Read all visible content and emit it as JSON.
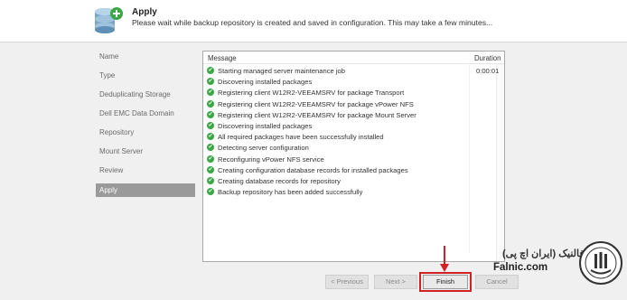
{
  "header": {
    "title": "Apply",
    "description": "Please wait while backup repository is created and saved in configuration. This may take a few minutes...",
    "icon": "database-add-icon"
  },
  "steps": [
    {
      "label": "Name",
      "active": false
    },
    {
      "label": "Type",
      "active": false
    },
    {
      "label": "Deduplicating Storage",
      "active": false
    },
    {
      "label": "Dell EMC Data Domain",
      "active": false
    },
    {
      "label": "Repository",
      "active": false
    },
    {
      "label": "Mount Server",
      "active": false
    },
    {
      "label": "Review",
      "active": false
    },
    {
      "label": "Apply",
      "active": true
    }
  ],
  "log": {
    "columns": {
      "message": "Message",
      "duration": "Duration"
    },
    "rows": [
      {
        "message": "Starting managed server maintenance job",
        "duration": "0:00:01"
      },
      {
        "message": "Discovering installed packages",
        "duration": ""
      },
      {
        "message": "Registering client W12R2-VEEAMSRV for package Transport",
        "duration": ""
      },
      {
        "message": "Registering client W12R2-VEEAMSRV for package vPower NFS",
        "duration": ""
      },
      {
        "message": "Registering client W12R2-VEEAMSRV for package Mount Server",
        "duration": ""
      },
      {
        "message": "Discovering installed packages",
        "duration": ""
      },
      {
        "message": "All required packages have been successfully installed",
        "duration": ""
      },
      {
        "message": "Detecting server configuration",
        "duration": ""
      },
      {
        "message": "Reconfiguring vPower NFS service",
        "duration": ""
      },
      {
        "message": "Creating configuration database records for installed packages",
        "duration": ""
      },
      {
        "message": "Creating database records for repository",
        "duration": ""
      },
      {
        "message": "Backup repository has been added successfully",
        "duration": ""
      }
    ]
  },
  "buttons": {
    "previous": "< Previous",
    "next": "Next >",
    "finish": "Finish",
    "cancel": "Cancel"
  },
  "branding": {
    "persian": "فالنیک (ایران اچ پی)",
    "english": "Falnic.com"
  },
  "colors": {
    "success": "#3aa845",
    "highlight": "#d32027",
    "active_step": "#9a9a9a"
  }
}
